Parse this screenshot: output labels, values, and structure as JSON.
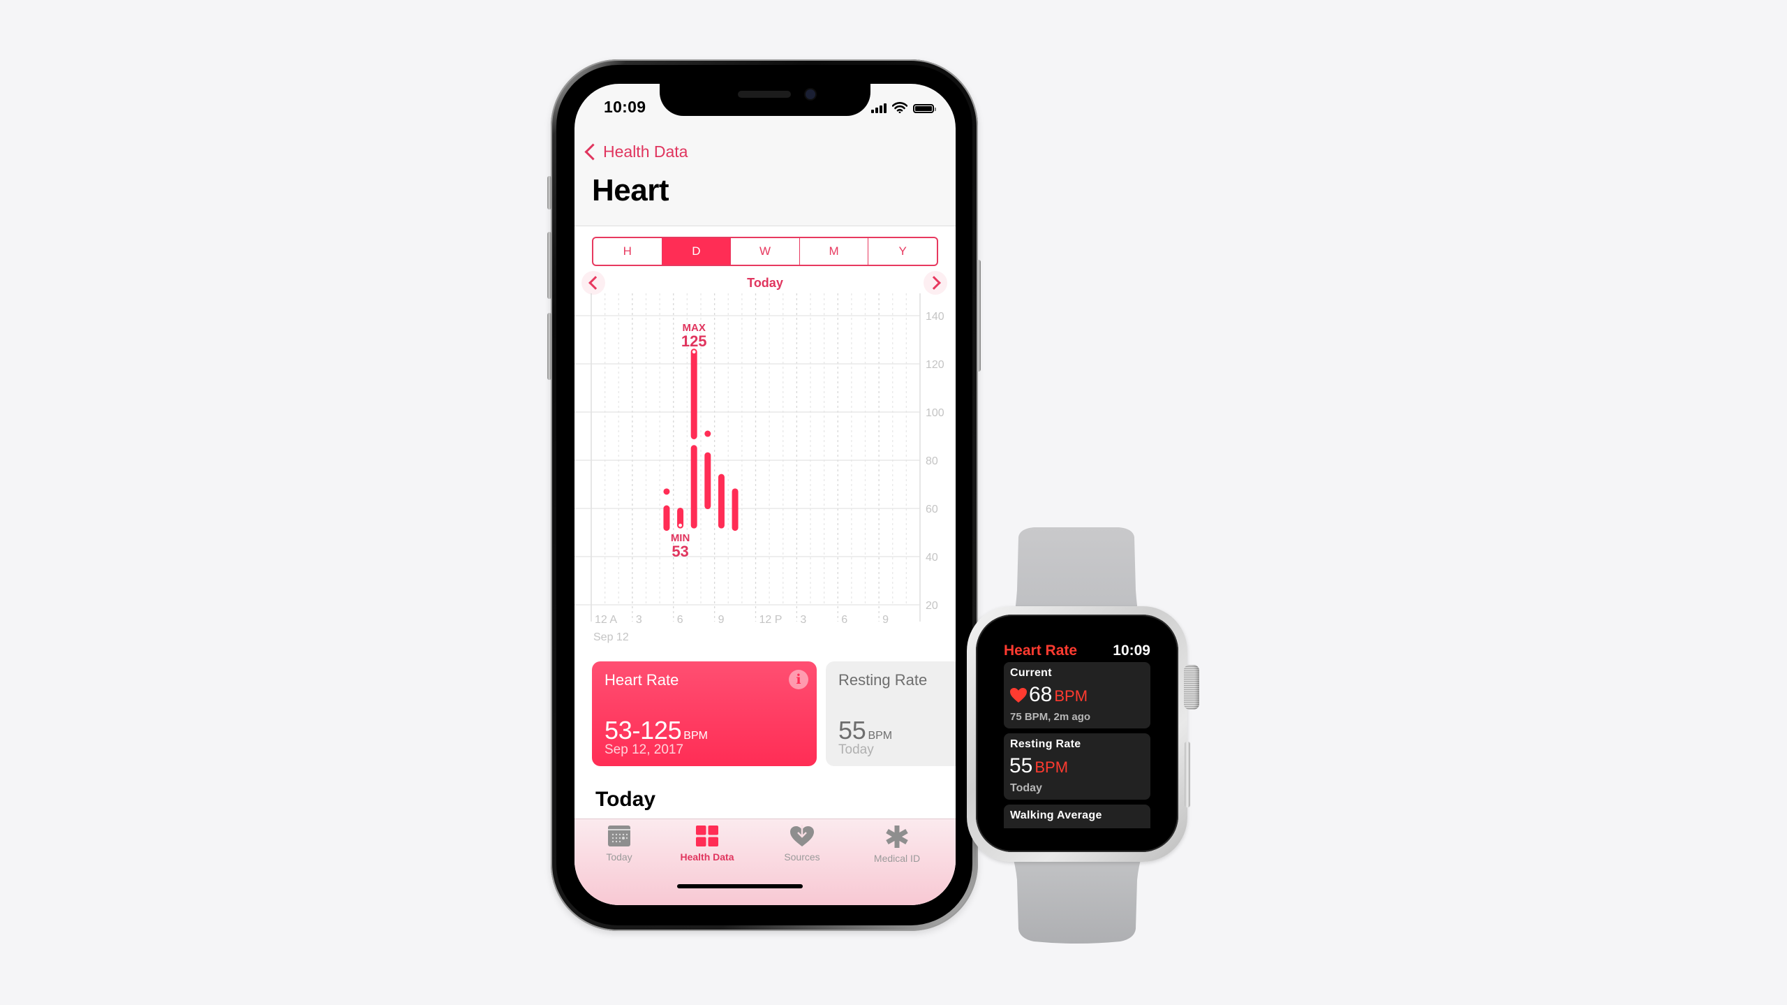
{
  "phone": {
    "status_bar": {
      "time": "10:09",
      "icons": [
        "cellular-signal-icon",
        "wifi-icon",
        "battery-icon"
      ]
    },
    "nav": {
      "back_label": "Health Data",
      "back_icon": "chevron-left-icon"
    },
    "title": "Heart",
    "segments": [
      {
        "label": "H",
        "active": false
      },
      {
        "label": "D",
        "active": true
      },
      {
        "label": "W",
        "active": false
      },
      {
        "label": "M",
        "active": false
      },
      {
        "label": "Y",
        "active": false
      }
    ],
    "period": {
      "label": "Today",
      "prev_icon": "chevron-left-icon",
      "next_icon": "chevron-right-icon"
    },
    "cards": {
      "heart_rate": {
        "title": "Heart Rate",
        "value": "53-125",
        "unit": "BPM",
        "subtitle": "Sep 12, 2017",
        "info_icon": "i"
      },
      "resting_rate": {
        "title": "Resting Rate",
        "value": "55",
        "unit": "BPM",
        "subtitle": "Today"
      }
    },
    "section_heading": "Today",
    "tabbar": [
      {
        "label": "Today",
        "icon": "calendar-icon",
        "active": false
      },
      {
        "label": "Health Data",
        "icon": "grid-icon",
        "active": true
      },
      {
        "label": "Sources",
        "icon": "heart-download-icon",
        "active": false
      },
      {
        "label": "Medical ID",
        "icon": "asterisk-icon",
        "active": false
      }
    ]
  },
  "chart_data": {
    "type": "bar",
    "subtype": "range-bar",
    "title": "",
    "xlabel": "",
    "ylabel": "",
    "x_unit": "hour of day",
    "xlim": [
      0,
      24
    ],
    "ylim": [
      13,
      142
    ],
    "y_ticks": [
      20,
      40,
      60,
      80,
      100,
      120,
      140
    ],
    "x_ticks": [
      {
        "hour": 0,
        "label": "12 A"
      },
      {
        "hour": 3,
        "label": "3"
      },
      {
        "hour": 6,
        "label": "6"
      },
      {
        "hour": 9,
        "label": "9"
      },
      {
        "hour": 12,
        "label": "12 P"
      },
      {
        "hour": 15,
        "label": "3"
      },
      {
        "hour": 18,
        "label": "6"
      },
      {
        "hour": 21,
        "label": "9"
      }
    ],
    "date_label": "Sep 12",
    "grid": true,
    "series": [
      {
        "name": "Heart Rate (BPM)",
        "color": "#ff2d55",
        "ranges": [
          {
            "hour": 5.5,
            "low": 52,
            "high": 60
          },
          {
            "hour": 5.5,
            "low": 67,
            "high": 67
          },
          {
            "hour": 6.5,
            "low": 53,
            "high": 59
          },
          {
            "hour": 7.5,
            "low": 53,
            "high": 85
          },
          {
            "hour": 7.5,
            "low": 90,
            "high": 125
          },
          {
            "hour": 8.5,
            "low": 61,
            "high": 82
          },
          {
            "hour": 8.5,
            "low": 91,
            "high": 91
          },
          {
            "hour": 9.5,
            "low": 53,
            "high": 73
          },
          {
            "hour": 10.5,
            "low": 52,
            "high": 67
          }
        ]
      }
    ],
    "annotations": [
      {
        "label": "MAX",
        "value": "125",
        "hour": 7.5,
        "at": 125,
        "position": "above"
      },
      {
        "label": "MIN",
        "value": "53",
        "hour": 6.5,
        "at": 53,
        "position": "below"
      }
    ]
  },
  "watch": {
    "app_title": "Heart Rate",
    "time": "10:09",
    "cards": [
      {
        "heading": "Current",
        "icon": "heart-icon",
        "value": "68",
        "unit": "BPM",
        "subtitle": "75 BPM, 2m ago"
      },
      {
        "heading": "Resting Rate",
        "value": "55",
        "unit": "BPM",
        "subtitle": "Today"
      },
      {
        "heading": "Walking Average"
      }
    ]
  },
  "colors": {
    "accent": "#ff2d55",
    "accent_text": "#e0355e",
    "watch_accent": "#ff3b30",
    "background": "#f5f5f7"
  }
}
